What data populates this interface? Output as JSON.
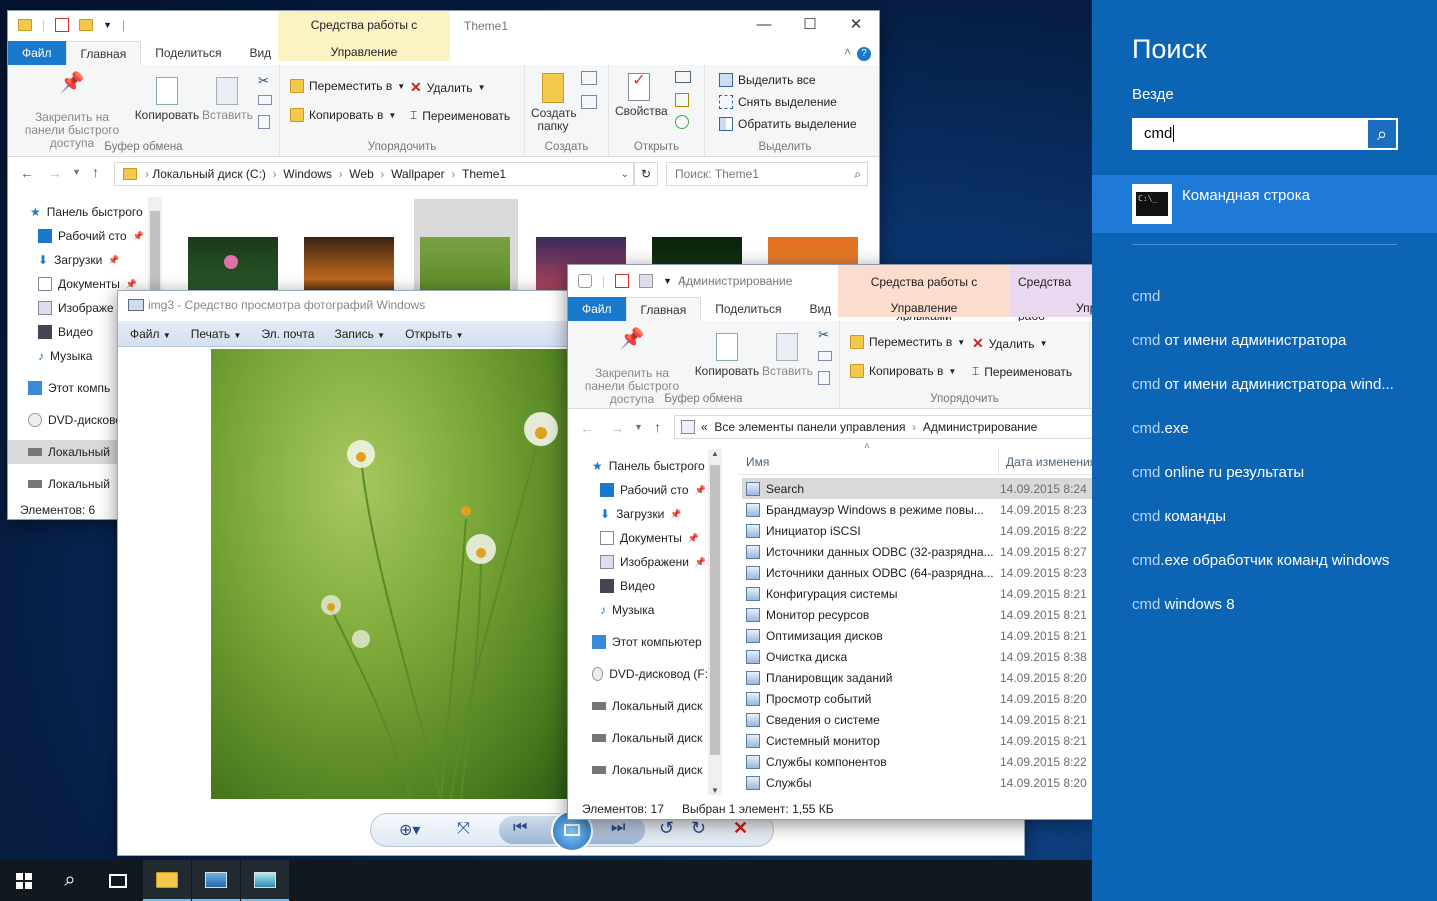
{
  "explorer1": {
    "title": "Theme1",
    "context_tab": "Средства работы с рисунками",
    "context_sub": "Управление",
    "tabs": [
      "Файл",
      "Главная",
      "Поделиться",
      "Вид"
    ],
    "pin": "Закрепить на панели быстрого доступа",
    "copy": "Копировать",
    "paste": "Вставить",
    "clipboard": "Буфер обмена",
    "move_to": "Переместить в",
    "copy_to": "Копировать в",
    "delete": "Удалить",
    "rename": "Переименовать",
    "organize": "Упорядочить",
    "new_folder": "Создать папку",
    "create": "Создать",
    "properties": "Свойства",
    "open": "Открыть",
    "select_all": "Выделить все",
    "deselect": "Снять выделение",
    "invert": "Обратить выделение",
    "select": "Выделить",
    "path": [
      "Локальный диск (C:)",
      "Windows",
      "Web",
      "Wallpaper",
      "Theme1"
    ],
    "search_placeholder": "Поиск: Theme1",
    "nav": [
      "Панель быстрого",
      "Рабочий сто",
      "Загрузки",
      "Документы",
      "Изображе",
      "Видео",
      "Музыка",
      "Этот компь",
      "DVD-дисково",
      "Локальный",
      "Локальный"
    ],
    "status": "Элементов: 6"
  },
  "photo": {
    "title": "img3 - Средство просмотра фотографий Windows",
    "menu": [
      "Файл",
      "Печать",
      "Эл. почта",
      "Запись",
      "Открыть"
    ]
  },
  "explorer2": {
    "title": "Администрирование",
    "context_tab": "Средства работы с ярлыками",
    "context_tab2": "Средства рабо",
    "context_sub": "Управление",
    "context_sub2": "Упр",
    "tabs": [
      "Файл",
      "Главная",
      "Поделиться",
      "Вид"
    ],
    "pin": "Закрепить на панели быстрого доступа",
    "copy": "Копировать",
    "paste": "Вставить",
    "clipboard": "Буфер обмена",
    "move_to": "Переместить в",
    "copy_to": "Копировать в",
    "delete": "Удалить",
    "rename": "Переименовать",
    "organize": "Упорядочить",
    "path_prefix": "«",
    "path": [
      "Все элементы панели управления",
      "Администрирование"
    ],
    "col_name": "Имя",
    "col_date": "Дата изменения",
    "nav": [
      "Панель быстрого",
      "Рабочий сто",
      "Загрузки",
      "Документы",
      "Изображени",
      "Видео",
      "Музыка",
      "Этот компьютер",
      "DVD-дисковод (F:",
      "Локальный диск",
      "Локальный диск",
      "Локальный диск"
    ],
    "files": [
      {
        "name": "Search",
        "date": "14.09.2015 8:24"
      },
      {
        "name": "Брандмауэр Windows в режиме повы...",
        "date": "14.09.2015 8:23"
      },
      {
        "name": "Инициатор iSCSI",
        "date": "14.09.2015 8:22"
      },
      {
        "name": "Источники данных ODBC (32-разрядна...",
        "date": "14.09.2015 8:27"
      },
      {
        "name": "Источники данных ODBC (64-разрядна...",
        "date": "14.09.2015 8:23"
      },
      {
        "name": "Конфигурация системы",
        "date": "14.09.2015 8:21"
      },
      {
        "name": "Монитор ресурсов",
        "date": "14.09.2015 8:21"
      },
      {
        "name": "Оптимизация дисков",
        "date": "14.09.2015 8:21"
      },
      {
        "name": "Очистка диска",
        "date": "14.09.2015 8:38"
      },
      {
        "name": "Планировщик заданий",
        "date": "14.09.2015 8:20"
      },
      {
        "name": "Просмотр событий",
        "date": "14.09.2015 8:20"
      },
      {
        "name": "Сведения о системе",
        "date": "14.09.2015 8:21"
      },
      {
        "name": "Системный монитор",
        "date": "14.09.2015 8:21"
      },
      {
        "name": "Службы компонентов",
        "date": "14.09.2015 8:22"
      },
      {
        "name": "Службы",
        "date": "14.09.2015 8:20"
      }
    ],
    "status_count": "Элементов: 17",
    "status_sel": "Выбран 1 элемент: 1,55 КБ"
  },
  "search": {
    "title": "Поиск",
    "scope": "Везде",
    "query": "cmd",
    "best": "Командная строка",
    "suggestions": [
      {
        "a": "cmd",
        "b": ""
      },
      {
        "a": "cmd",
        "b": " от имени администратора"
      },
      {
        "a": "cmd",
        "b": " от имени администратора wind..."
      },
      {
        "a": "cmd",
        "b": ".exe"
      },
      {
        "a": "cmd",
        "b": " online ru результаты"
      },
      {
        "a": "cmd",
        "b": " команды"
      },
      {
        "a": "cmd",
        "b": ".exe обработчик команд windows"
      },
      {
        "a": "cmd",
        "b": " windows 8"
      }
    ]
  },
  "colors": {
    "accent": "#1979ca",
    "search_bg": "#0c64b4",
    "search_sel": "#1e7ad6"
  }
}
